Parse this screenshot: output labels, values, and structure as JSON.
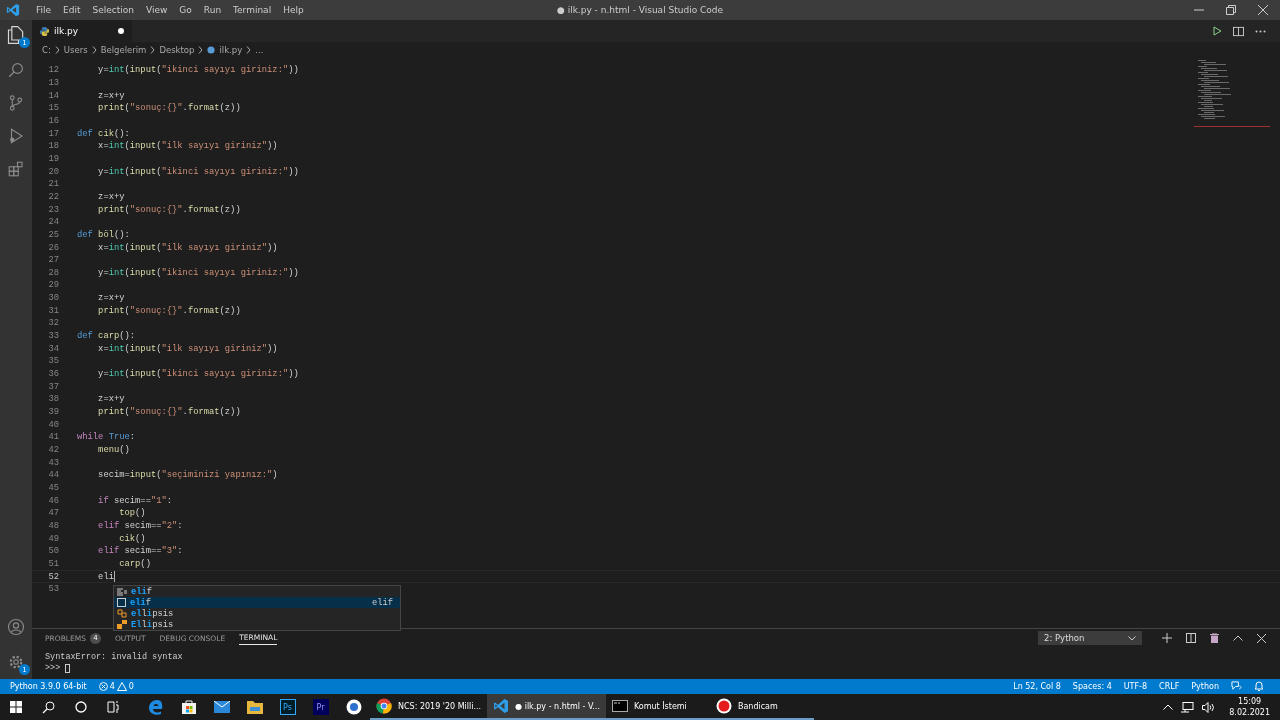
{
  "window": {
    "title": "● ilk.py - n.html - Visual Studio Code"
  },
  "menu": [
    "File",
    "Edit",
    "Selection",
    "View",
    "Go",
    "Run",
    "Terminal",
    "Help"
  ],
  "activity_bar": {
    "explorer_badge": "1",
    "settings_badge": "1"
  },
  "tabs": [
    {
      "label": "ilk.py",
      "selected": true,
      "dirty": true
    }
  ],
  "breadcrumb": [
    "C:",
    "Users",
    "Belgelerim",
    "Desktop",
    "ilk.py",
    "..."
  ],
  "editor": {
    "lines": [
      {
        "number": "12",
        "current": false,
        "tokens": [
          {
            "text": "    y=",
            "kind": "plain"
          },
          {
            "text": "int",
            "kind": "builtin"
          },
          {
            "text": "(",
            "kind": "plain"
          },
          {
            "text": "input",
            "kind": "function"
          },
          {
            "text": "(",
            "kind": "plain"
          },
          {
            "text": "\"ikinci sayıyı giriniz:\"",
            "kind": "string"
          },
          {
            "text": "))",
            "kind": "plain"
          }
        ]
      },
      {
        "number": "13",
        "current": false
      },
      {
        "number": "14",
        "current": false,
        "tokens": [
          {
            "text": "    z=x+y",
            "kind": "plain"
          }
        ]
      },
      {
        "number": "15",
        "current": false,
        "tokens": [
          {
            "text": "    print",
            "kind": "function"
          },
          {
            "text": "(",
            "kind": "plain"
          },
          {
            "text": "\"sonuç:{}\"",
            "kind": "string"
          },
          {
            "text": ".",
            "kind": "plain"
          },
          {
            "text": "format",
            "kind": "function"
          },
          {
            "text": "(z))",
            "kind": "plain"
          }
        ]
      },
      {
        "number": "16",
        "current": false
      },
      {
        "number": "17",
        "current": false,
        "tokens": [
          {
            "text": "def",
            "kind": "keyword"
          },
          {
            "text": " cik",
            "kind": "function"
          },
          {
            "text": "():",
            "kind": "plain"
          }
        ]
      },
      {
        "number": "18",
        "current": false,
        "tokens": [
          {
            "text": "    x=",
            "kind": "plain"
          },
          {
            "text": "int",
            "kind": "builtin"
          },
          {
            "text": "(",
            "kind": "plain"
          },
          {
            "text": "input",
            "kind": "function"
          },
          {
            "text": "(",
            "kind": "plain"
          },
          {
            "text": "\"ilk sayıyı giriniz\"",
            "kind": "string"
          },
          {
            "text": "))",
            "kind": "plain"
          }
        ]
      },
      {
        "number": "19",
        "current": false
      },
      {
        "number": "20",
        "current": false,
        "tokens": [
          {
            "text": "    y=",
            "kind": "plain"
          },
          {
            "text": "int",
            "kind": "builtin"
          },
          {
            "text": "(",
            "kind": "plain"
          },
          {
            "text": "input",
            "kind": "function"
          },
          {
            "text": "(",
            "kind": "plain"
          },
          {
            "text": "\"ikinci sayıyı giriniz:\"",
            "kind": "string"
          },
          {
            "text": "))",
            "kind": "plain"
          }
        ]
      },
      {
        "number": "21",
        "current": false
      },
      {
        "number": "22",
        "current": false,
        "tokens": [
          {
            "text": "    z=x+y",
            "kind": "plain"
          }
        ]
      },
      {
        "number": "23",
        "current": false,
        "tokens": [
          {
            "text": "    print",
            "kind": "function"
          },
          {
            "text": "(",
            "kind": "plain"
          },
          {
            "text": "\"sonuç:{}\"",
            "kind": "string"
          },
          {
            "text": ".",
            "kind": "plain"
          },
          {
            "text": "format",
            "kind": "function"
          },
          {
            "text": "(z))",
            "kind": "plain"
          }
        ]
      },
      {
        "number": "24",
        "current": false
      },
      {
        "number": "25",
        "current": false,
        "tokens": [
          {
            "text": "def",
            "kind": "keyword"
          },
          {
            "text": " böl",
            "kind": "function"
          },
          {
            "text": "():",
            "kind": "plain"
          }
        ]
      },
      {
        "number": "26",
        "current": false,
        "tokens": [
          {
            "text": "    x=",
            "kind": "plain"
          },
          {
            "text": "int",
            "kind": "builtin"
          },
          {
            "text": "(",
            "kind": "plain"
          },
          {
            "text": "input",
            "kind": "function"
          },
          {
            "text": "(",
            "kind": "plain"
          },
          {
            "text": "\"ilk sayıyı giriniz\"",
            "kind": "string"
          },
          {
            "text": "))",
            "kind": "plain"
          }
        ]
      },
      {
        "number": "27",
        "current": false
      },
      {
        "number": "28",
        "current": false,
        "tokens": [
          {
            "text": "    y=",
            "kind": "plain"
          },
          {
            "text": "int",
            "kind": "builtin"
          },
          {
            "text": "(",
            "kind": "plain"
          },
          {
            "text": "input",
            "kind": "function"
          },
          {
            "text": "(",
            "kind": "plain"
          },
          {
            "text": "\"ikinci sayıyı giriniz:\"",
            "kind": "string"
          },
          {
            "text": "))",
            "kind": "plain"
          }
        ]
      },
      {
        "number": "29",
        "current": false
      },
      {
        "number": "30",
        "current": false,
        "tokens": [
          {
            "text": "    z=x+y",
            "kind": "plain"
          }
        ]
      },
      {
        "number": "31",
        "current": false,
        "tokens": [
          {
            "text": "    print",
            "kind": "function"
          },
          {
            "text": "(",
            "kind": "plain"
          },
          {
            "text": "\"sonuç:{}\"",
            "kind": "string"
          },
          {
            "text": ".",
            "kind": "plain"
          },
          {
            "text": "format",
            "kind": "function"
          },
          {
            "text": "(z))",
            "kind": "plain"
          }
        ]
      },
      {
        "number": "32",
        "current": false
      },
      {
        "number": "33",
        "current": false,
        "tokens": [
          {
            "text": "def",
            "kind": "keyword"
          },
          {
            "text": " carp",
            "kind": "function"
          },
          {
            "text": "():",
            "kind": "plain"
          }
        ]
      },
      {
        "number": "34",
        "current": false,
        "tokens": [
          {
            "text": "    x=",
            "kind": "plain"
          },
          {
            "text": "int",
            "kind": "builtin"
          },
          {
            "text": "(",
            "kind": "plain"
          },
          {
            "text": "input",
            "kind": "function"
          },
          {
            "text": "(",
            "kind": "plain"
          },
          {
            "text": "\"ilk sayıyı giriniz\"",
            "kind": "string"
          },
          {
            "text": "))",
            "kind": "plain"
          }
        ]
      },
      {
        "number": "35",
        "current": false
      },
      {
        "number": "36",
        "current": false,
        "tokens": [
          {
            "text": "    y=",
            "kind": "plain"
          },
          {
            "text": "int",
            "kind": "builtin"
          },
          {
            "text": "(",
            "kind": "plain"
          },
          {
            "text": "input",
            "kind": "function"
          },
          {
            "text": "(",
            "kind": "plain"
          },
          {
            "text": "\"ikinci sayıyı giriniz:\"",
            "kind": "string"
          },
          {
            "text": "))",
            "kind": "plain"
          }
        ]
      },
      {
        "number": "37",
        "current": false
      },
      {
        "number": "38",
        "current": false,
        "tokens": [
          {
            "text": "    z=x+y",
            "kind": "plain"
          }
        ]
      },
      {
        "number": "39",
        "current": false,
        "tokens": [
          {
            "text": "    print",
            "kind": "function"
          },
          {
            "text": "(",
            "kind": "plain"
          },
          {
            "text": "\"sonuç:{}\"",
            "kind": "string"
          },
          {
            "text": ".",
            "kind": "plain"
          },
          {
            "text": "format",
            "kind": "function"
          },
          {
            "text": "(z))",
            "kind": "plain"
          }
        ]
      },
      {
        "number": "40",
        "current": false
      },
      {
        "number": "41",
        "current": false,
        "tokens": [
          {
            "text": "while",
            "kind": "control"
          },
          {
            "text": " True",
            "kind": "keyword"
          },
          {
            "text": ":",
            "kind": "plain"
          }
        ]
      },
      {
        "number": "42",
        "current": false,
        "tokens": [
          {
            "text": "    menu",
            "kind": "function"
          },
          {
            "text": "()",
            "kind": "plain"
          }
        ]
      },
      {
        "number": "43",
        "current": false
      },
      {
        "number": "44",
        "current": false,
        "tokens": [
          {
            "text": "    secim=",
            "kind": "plain"
          },
          {
            "text": "input",
            "kind": "function"
          },
          {
            "text": "(",
            "kind": "plain"
          },
          {
            "text": "\"seçiminizi yapınız:\"",
            "kind": "string"
          },
          {
            "text": ")",
            "kind": "plain"
          }
        ]
      },
      {
        "number": "45",
        "current": false
      },
      {
        "number": "46",
        "current": false,
        "tokens": [
          {
            "text": "    if",
            "kind": "control"
          },
          {
            "text": " secim==",
            "kind": "plain"
          },
          {
            "text": "\"1\"",
            "kind": "string"
          },
          {
            "text": ":",
            "kind": "plain"
          }
        ]
      },
      {
        "number": "47",
        "current": false,
        "tokens": [
          {
            "text": "        top",
            "kind": "function"
          },
          {
            "text": "()",
            "kind": "plain"
          }
        ]
      },
      {
        "number": "48",
        "current": false,
        "tokens": [
          {
            "text": "    elif",
            "kind": "control"
          },
          {
            "text": " secim==",
            "kind": "plain"
          },
          {
            "text": "\"2\"",
            "kind": "string"
          },
          {
            "text": ":",
            "kind": "plain"
          }
        ]
      },
      {
        "number": "49",
        "current": false,
        "tokens": [
          {
            "text": "        cik",
            "kind": "function"
          },
          {
            "text": "()",
            "kind": "plain"
          }
        ]
      },
      {
        "number": "50",
        "current": false,
        "tokens": [
          {
            "text": "    elif",
            "kind": "control"
          },
          {
            "text": " secim==",
            "kind": "plain"
          },
          {
            "text": "\"3\"",
            "kind": "string"
          },
          {
            "text": ":",
            "kind": "plain"
          }
        ]
      },
      {
        "number": "51",
        "current": false,
        "tokens": [
          {
            "text": "        carp",
            "kind": "function"
          },
          {
            "text": "()",
            "kind": "plain"
          }
        ]
      },
      {
        "number": "52",
        "current": true,
        "tokens": [
          {
            "text": "    eli",
            "kind": "plain"
          }
        ]
      },
      {
        "number": "53",
        "current": false
      }
    ]
  },
  "suggestions": [
    {
      "kind": "snippet",
      "label": "**eli**f",
      "selected": false
    },
    {
      "kind": "keyword",
      "label": "**eli**f",
      "selected": true,
      "detail": "elif"
    },
    {
      "kind": "variable",
      "label": "**el**l**i**psis",
      "selected": false
    },
    {
      "kind": "class",
      "label": "**El**l**i**psis",
      "selected": false
    }
  ],
  "panel": {
    "tabs": [
      {
        "label": "PROBLEMS",
        "badge": "4",
        "selected": false
      },
      {
        "label": "OUTPUT",
        "selected": false
      },
      {
        "label": "DEBUG CONSOLE",
        "selected": false
      },
      {
        "label": "TERMINAL",
        "selected": true
      }
    ],
    "terminal_select": "2: Python",
    "terminal_lines": [
      "SyntaxError: invalid syntax",
      ">>>"
    ]
  },
  "status_bar": {
    "interpreter": "Python 3.9.0 64-bit",
    "errors": "4",
    "warnings": "0",
    "right": [
      "Ln 52, Col 8",
      "Spaces: 4",
      "UTF-8",
      "CRLF",
      "Python"
    ]
  },
  "taskbar": {
    "apps": [
      {
        "kind": "edge",
        "selected": false
      },
      {
        "kind": "store",
        "selected": false
      },
      {
        "kind": "mail",
        "selected": false
      },
      {
        "kind": "files",
        "selected": false
      },
      {
        "kind": "ps",
        "badge_text": "Ps",
        "selected": false
      },
      {
        "kind": "pr",
        "badge_text": "Pr",
        "selected": false
      },
      {
        "kind": "circle-app",
        "selected": false
      },
      {
        "kind": "chrome",
        "label": "NCS: 2019 '20 Milli...",
        "selected": false
      },
      {
        "kind": "vscode",
        "label": "● ilk.py - n.html - V...",
        "selected": true
      },
      {
        "kind": "cmd",
        "label": "Komut İstemi",
        "selected": false
      },
      {
        "kind": "record",
        "label": "Bandicam",
        "selected": false
      }
    ],
    "time": "15:09",
    "date": "8.02.2021"
  }
}
